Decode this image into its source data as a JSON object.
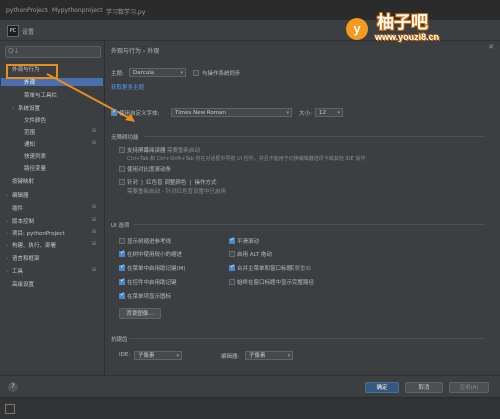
{
  "titlebar": {
    "project": "pythonProject",
    "sep": "›",
    "folder": "Mypythonproject",
    "file": "学习数学习.py"
  },
  "dialog": {
    "title": "设置",
    "icon": "PC"
  },
  "left": {
    "search_placeholder": "Q↓",
    "tree": [
      {
        "label": "外观与行为",
        "indent": 0,
        "arrow": "▾",
        "selected": false
      },
      {
        "label": "外观",
        "indent": 2,
        "arrow": "",
        "selected": true
      },
      {
        "label": "菜单与工具栏",
        "indent": 2,
        "arrow": "",
        "selected": false
      },
      {
        "label": "系统设置",
        "indent": 1,
        "arrow": "›",
        "selected": false
      },
      {
        "label": "文件颜色",
        "indent": 2,
        "arrow": "",
        "selected": false
      },
      {
        "label": "范围",
        "indent": 2,
        "arrow": "",
        "selected": false
      },
      {
        "label": "通知",
        "indent": 2,
        "arrow": "",
        "selected": false
      },
      {
        "label": "快速列表",
        "indent": 2,
        "arrow": "",
        "selected": false
      },
      {
        "label": "路径变量",
        "indent": 2,
        "arrow": "",
        "selected": false
      },
      {
        "label": "按键映射",
        "indent": 0,
        "arrow": "",
        "selected": false
      },
      {
        "label": "编辑器",
        "indent": 0,
        "arrow": "›",
        "selected": false
      },
      {
        "label": "插件",
        "indent": 0,
        "arrow": "",
        "selected": false
      },
      {
        "label": "版本控制",
        "indent": 0,
        "arrow": "›",
        "selected": false
      },
      {
        "label": "项目: pythonProject",
        "indent": 0,
        "arrow": "›",
        "selected": false
      },
      {
        "label": "构建、执行、部署",
        "indent": 0,
        "arrow": "›",
        "selected": false
      },
      {
        "label": "语言和框架",
        "indent": 0,
        "arrow": "›",
        "selected": false
      },
      {
        "label": "工具",
        "indent": 0,
        "arrow": "›",
        "selected": false
      },
      {
        "label": "高级设置",
        "indent": 0,
        "arrow": "",
        "selected": false
      }
    ]
  },
  "main": {
    "breadcrumb": "外观与行为  ›  外观",
    "theme_label": "主题:",
    "theme_value": "Darcula",
    "sync_os_label": "与操作系统同步",
    "get_more_themes": "获取更多主题",
    "custom_font_label": "使用自定义字体:",
    "font_value": "Times New Roman",
    "size_label": "大小:",
    "size_value": "12",
    "accessibility_header": "无障碍功能",
    "screen_reader_label": "支持屏幕阅读器",
    "screen_reader_note": "需要重新启动",
    "screen_reader_desc": "Ctrl+Tab 和 Ctrl+Shift+Tab 将在对话框中导航 UI 控件，并且不能用于切换编辑器选项卡或其他 IDE 操作",
    "contrast_scrollbars_label": "使用对比度滚动条",
    "color_deficiency_label": "针对 ❘ 红色盲 调整颜色 ❘ 操作方式",
    "color_deficiency_note": "需要重新启动 - 针对红色盲设置中已启用",
    "ui_options_header": "UI 选项",
    "opt_tree_indent": "显示树缩进参考线",
    "opt_compact_mode": "在树中使用较小的缩进",
    "opt_ctrl_dialogs": "在菜单中启用助记键(M)",
    "opt_controls_mnemonic": "在控件中启用助记键",
    "opt_menu_icons": "在菜单项显示图标",
    "opt_smooth_scroll": "平滑滚动",
    "opt_alt_drag": "启用 ALT 拖动",
    "opt_merge_menus": "合并主菜单和窗口标题",
    "opt_merge_note": "需要重启",
    "opt_show_main_menu": "始终在窗口标题中显示完整路径",
    "background_image_btn": "背景图像...",
    "antialias_header": "抗锯齿",
    "ide_label": "IDE:",
    "ide_value": "子像素",
    "editor_label": "编辑器:",
    "editor_value": "子像素"
  },
  "footer": {
    "help": "?",
    "ok": "确定",
    "cancel": "取消",
    "apply": "应用(A)"
  },
  "watermark": {
    "circle": "y",
    "name": "柚子吧",
    "url": "www.youzi8.cn"
  },
  "colors": {
    "bg": "#3c3f41",
    "selected": "#4b6eaf",
    "highlight": "#e98e1a",
    "link": "#589df6",
    "primary_button": "#365880"
  }
}
